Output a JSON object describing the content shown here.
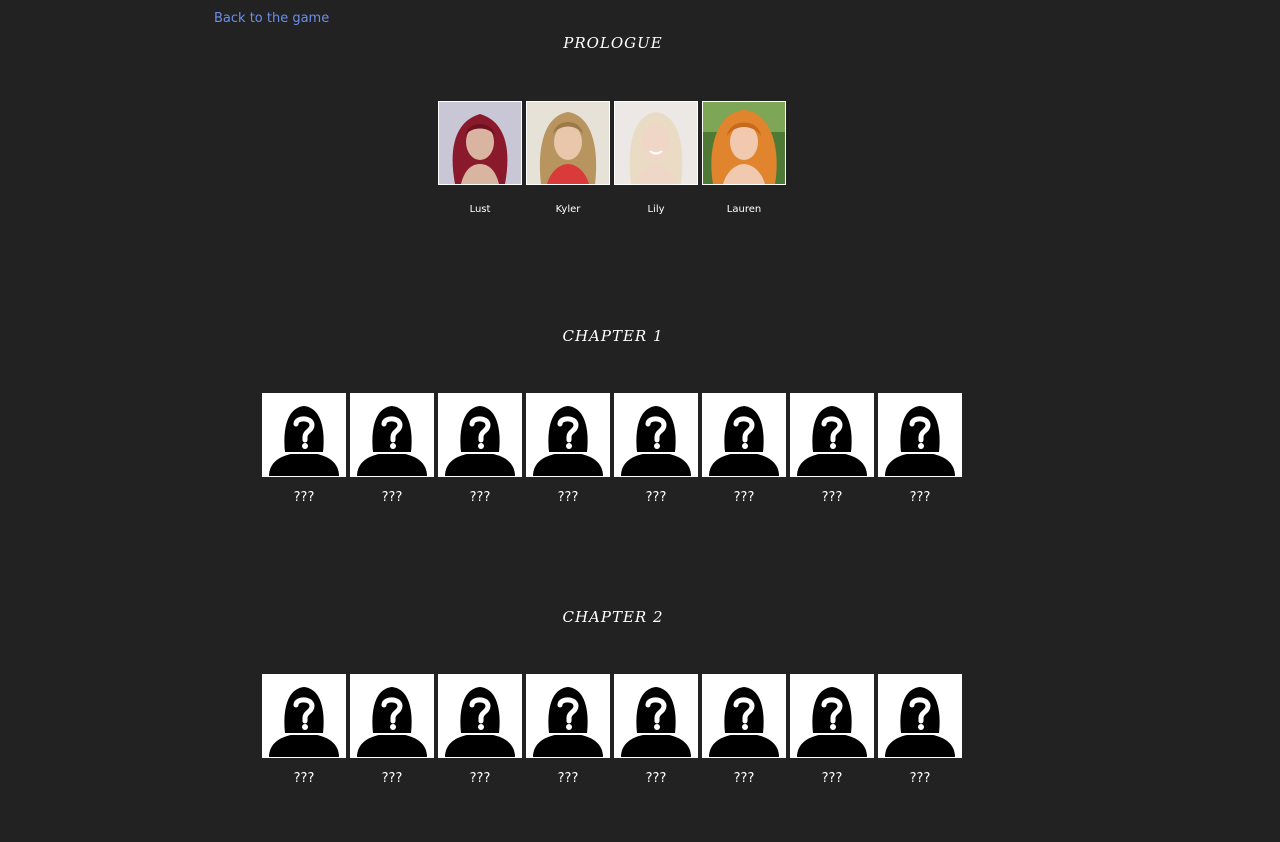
{
  "nav": {
    "back_label": "Back to the game"
  },
  "prologue": {
    "title": "PROLOGUE",
    "characters": [
      {
        "name": "Lust",
        "hair_color": "#8a1a2b",
        "bg_color": "#c9c7d6",
        "skin_color": "#d9b4a0"
      },
      {
        "name": "Kyler",
        "hair_color": "#b8945e",
        "bg_color": "#e6e2d8",
        "skin_color": "#e8c7aa"
      },
      {
        "name": "Lily",
        "hair_color": "#eadcc4",
        "bg_color": "#ece8e6",
        "skin_color": "#f0d6c6"
      },
      {
        "name": "Lauren",
        "hair_color": "#e0842e",
        "bg_color": "#4f7a36",
        "skin_color": "#f0c9ae"
      }
    ]
  },
  "chapter1": {
    "title": "CHAPTER 1",
    "characters": [
      "???",
      "???",
      "???",
      "???",
      "???",
      "???",
      "???",
      "???"
    ]
  },
  "chapter2": {
    "title": "CHAPTER 2",
    "characters": [
      "???",
      "???",
      "???",
      "???",
      "???",
      "???",
      "???",
      "???"
    ]
  },
  "icons": {
    "unknown": "unknown-person-silhouette-icon"
  },
  "colors": {
    "background": "#222222",
    "link": "#6c8ee8",
    "text": "#ffffff"
  }
}
